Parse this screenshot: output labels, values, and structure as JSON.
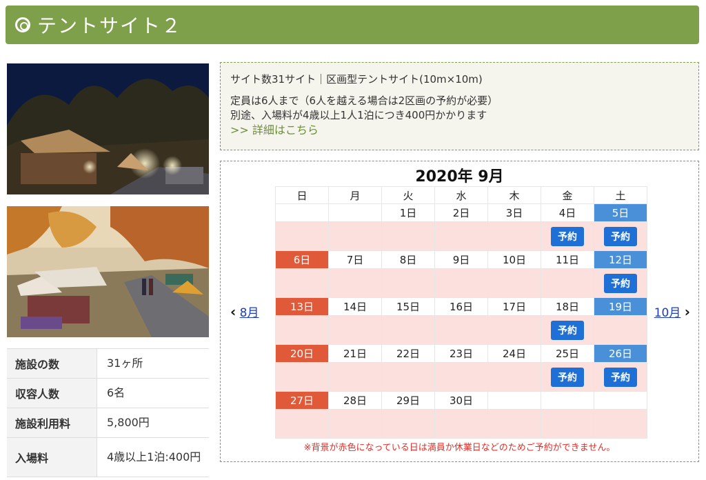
{
  "header": {
    "title": "テントサイト２"
  },
  "info_table": [
    {
      "label": "施設の数",
      "value": "31ヶ所"
    },
    {
      "label": "収容人数",
      "value": "6名"
    },
    {
      "label": "施設利用料",
      "value": "5,800円"
    },
    {
      "label": "入場料",
      "value": "4歳以上1泊:400円"
    }
  ],
  "description": {
    "line1": "サイト数31サイト｜区画型テントサイト(10m×10m)",
    "line2": "定員は6人まで（6人を越える場合は2区画の予約が必要）",
    "line3": "別途、入場料が4歳以上1人1泊につき400円かかります",
    "more_link": ">> 詳細はこちら"
  },
  "calendar": {
    "title": "2020年  9月",
    "prev_label": "8月",
    "next_label": "10月",
    "weekdays": [
      "日",
      "月",
      "火",
      "水",
      "木",
      "金",
      "土"
    ],
    "reserve_label": "予約",
    "weeks": [
      [
        "",
        "",
        "1日",
        "2日",
        "3日",
        "4日",
        "5日"
      ],
      [
        "6日",
        "7日",
        "8日",
        "9日",
        "10日",
        "11日",
        "12日"
      ],
      [
        "13日",
        "14日",
        "15日",
        "16日",
        "17日",
        "18日",
        "19日"
      ],
      [
        "20日",
        "21日",
        "22日",
        "23日",
        "24日",
        "25日",
        "26日"
      ],
      [
        "27日",
        "28日",
        "29日",
        "30日",
        "",
        "",
        ""
      ]
    ],
    "note": "※背景が赤色になっている日は満員か休業日などのためご予約ができません。"
  },
  "colors": {
    "header_green": "#7ea04a",
    "full_pink": "#fce0dd",
    "sunday": "#e05a3a",
    "saturday": "#4a90d8",
    "reserve_button": "#1e6fd6"
  }
}
